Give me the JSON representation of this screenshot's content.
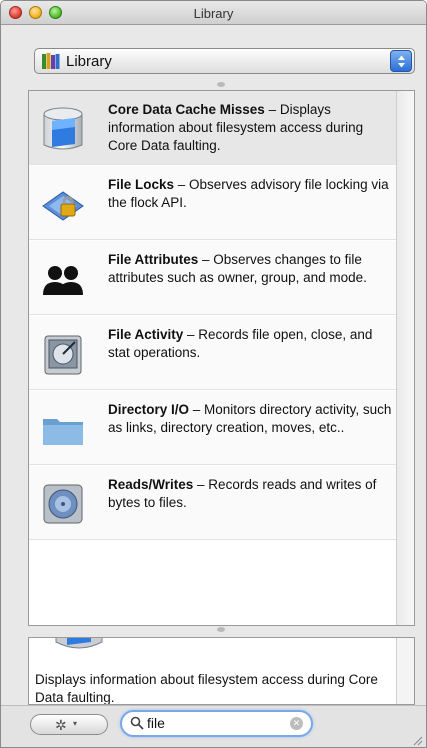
{
  "window": {
    "title": "Library"
  },
  "library_popup": {
    "selected": "Library"
  },
  "instruments": [
    {
      "title": "Core Data Cache Misses",
      "description": " – Displays information about filesystem access during Core Data faulting.",
      "icon": "database-cylinder-icon"
    },
    {
      "title": "File Locks",
      "description": " – Observes advisory file locking via the flock API.",
      "icon": "file-lock-icon"
    },
    {
      "title": "File Attributes",
      "description": " – Observes changes to file attributes such as owner, group, and mode.",
      "icon": "users-icon"
    },
    {
      "title": "File Activity",
      "description": " – Records file open, close, and stat operations.",
      "icon": "hard-drive-icon"
    },
    {
      "title": "Directory I/O",
      "description": " – Monitors directory activity, such as links, directory creation, moves, etc..",
      "icon": "folder-icon"
    },
    {
      "title": "Reads/Writes",
      "description": " – Records reads and writes of bytes to files.",
      "icon": "disk-icon"
    }
  ],
  "detail": {
    "text": "Displays information about filesystem access during Core Data faulting."
  },
  "search": {
    "value": "file"
  },
  "colors": {
    "selection": "#e7e7e7",
    "search_focus": "#7aa7e8",
    "stepper": "#2c6ed5"
  }
}
